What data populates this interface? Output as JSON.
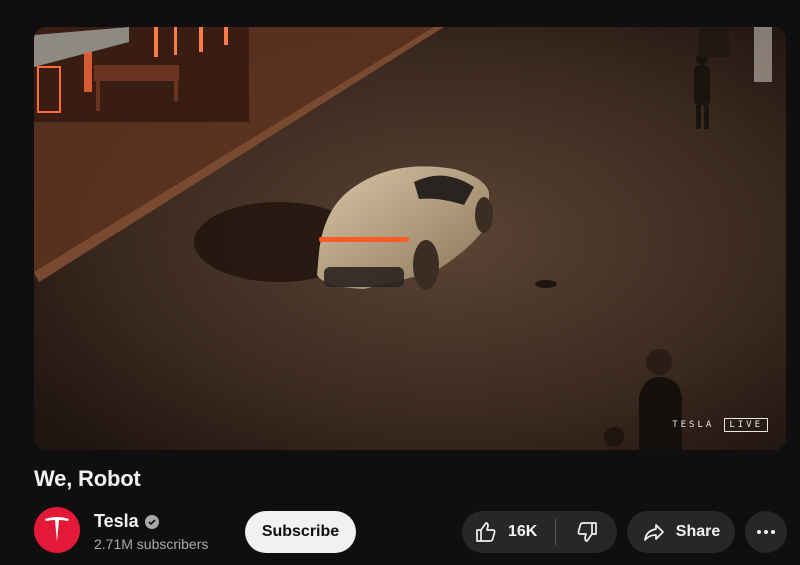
{
  "video": {
    "title": "We, Robot",
    "overlay_brand": "TESLA",
    "overlay_live": "LIVE"
  },
  "channel": {
    "name": "Tesla",
    "subscribers": "2.71M subscribers",
    "avatar_color": "#e31937",
    "verified": true
  },
  "actions": {
    "subscribe_label": "Subscribe",
    "like_count": "16K",
    "share_label": "Share",
    "like_icon": "thumbs-up-icon",
    "dislike_icon": "thumbs-down-icon",
    "share_icon": "share-arrow-icon",
    "more_icon": "more-horizontal-icon"
  },
  "theme": {
    "background": "#0f0f0f",
    "pill_background": "#272727",
    "text": "#f1f1f1",
    "secondary_text": "#aaaaaa"
  }
}
